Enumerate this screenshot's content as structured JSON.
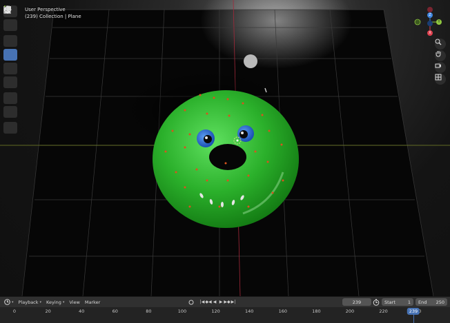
{
  "viewport": {
    "view_name": "User Perspective",
    "context": "(239) Collection | Plane"
  },
  "toolbar": {
    "tools": [
      {
        "name": "select-box-tool",
        "icon": "select-box-icon",
        "active": false
      },
      {
        "name": "cursor-tool",
        "icon": "cursor-icon",
        "active": false
      },
      {
        "name": "move-tool",
        "icon": "move-icon",
        "active": false
      },
      {
        "name": "rotate-tool",
        "icon": "rotate-icon",
        "active": true
      },
      {
        "name": "scale-tool",
        "icon": "scale-icon",
        "active": false
      },
      {
        "name": "transform-tool",
        "icon": "transform-icon",
        "active": false
      },
      {
        "name": "annotate-tool",
        "icon": "annotate-icon",
        "active": false
      },
      {
        "name": "measure-tool",
        "icon": "measure-icon",
        "active": false
      },
      {
        "name": "add-cube-tool",
        "icon": "add-cube-icon",
        "active": false
      }
    ]
  },
  "gizmo": {
    "z_label": "Z",
    "y_label": "Y",
    "x_label": "X",
    "colors": {
      "x": "#e0414f",
      "y": "#8ec63f",
      "z": "#3f86e0"
    }
  },
  "nav_buttons": [
    "zoom-icon",
    "hand-pan-icon",
    "camera-icon",
    "grid-view-icon"
  ],
  "timeline": {
    "menu": [
      {
        "label": "Playback",
        "dropdown": true
      },
      {
        "label": "Keying",
        "dropdown": true
      },
      {
        "label": "View",
        "dropdown": false
      },
      {
        "label": "Marker",
        "dropdown": false
      }
    ],
    "current_frame": "239",
    "start_label": "Start",
    "start_value": "1",
    "end_label": "End",
    "end_value": "250",
    "ruler_ticks": [
      "0",
      "20",
      "40",
      "60",
      "80",
      "100",
      "120",
      "140",
      "160",
      "180",
      "200",
      "220",
      "240"
    ],
    "playhead_frame": "239"
  },
  "colors": {
    "accent": "#4772b3",
    "donut": "#2fb52f",
    "eye": "#2f6fd6",
    "sprinkles": "#d9531e"
  }
}
